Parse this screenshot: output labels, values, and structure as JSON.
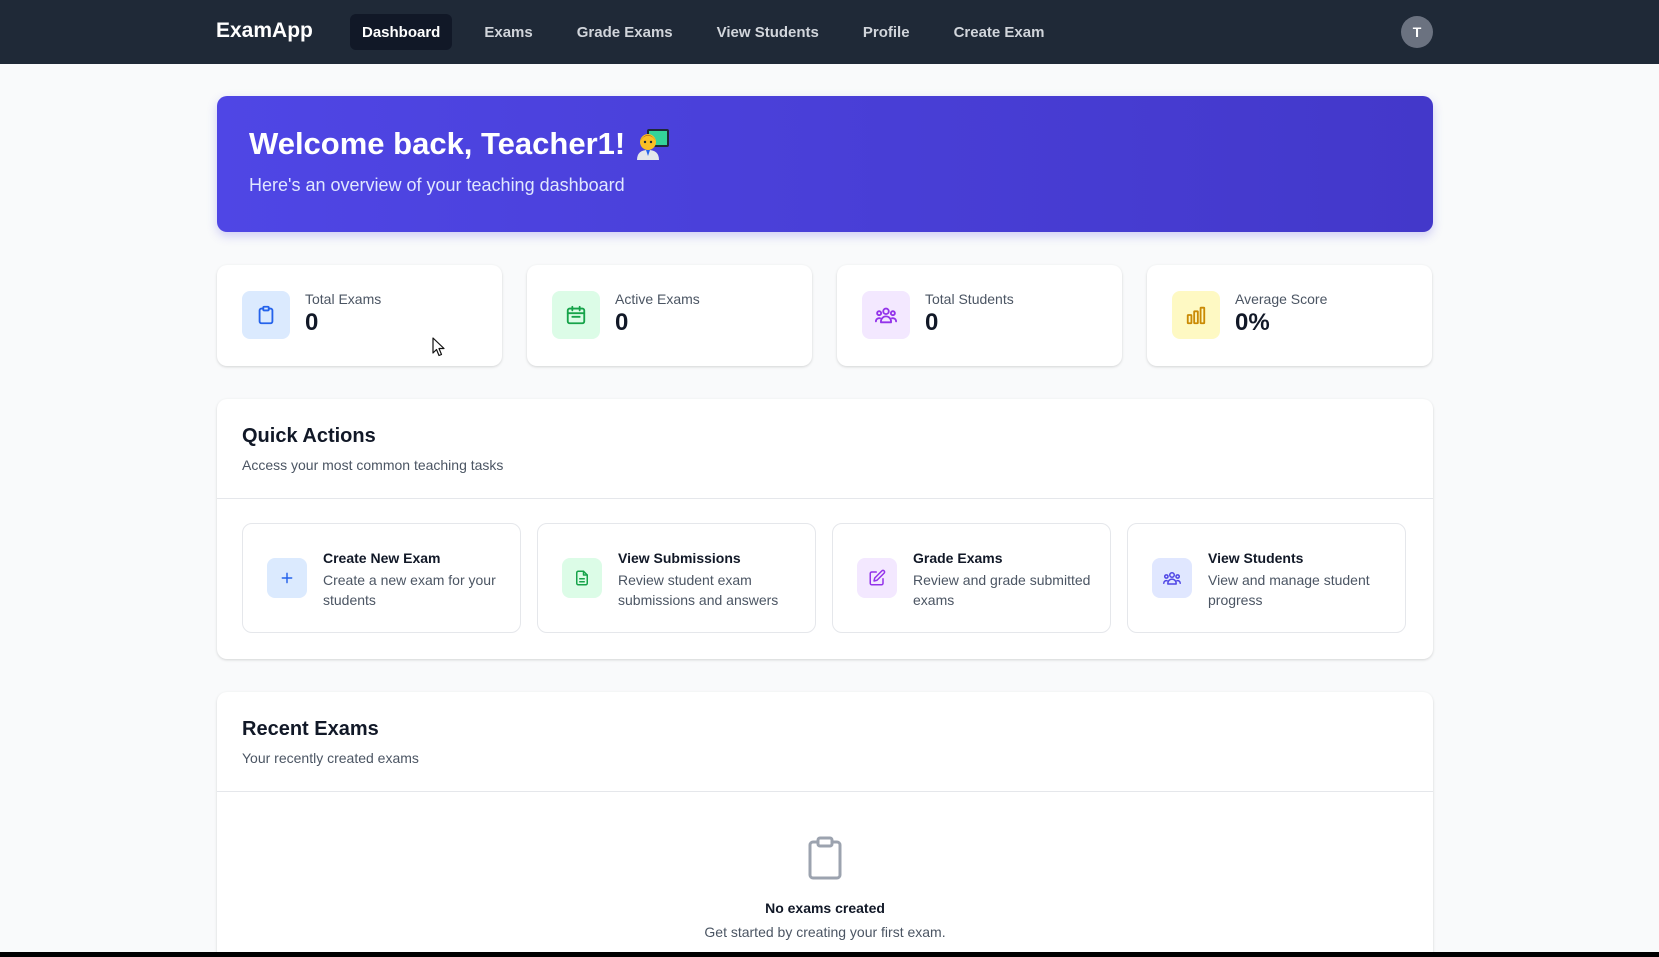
{
  "nav": {
    "brand": "ExamApp",
    "links": [
      {
        "label": "Dashboard",
        "active": true
      },
      {
        "label": "Exams"
      },
      {
        "label": "Grade Exams"
      },
      {
        "label": "View Students"
      },
      {
        "label": "Profile"
      },
      {
        "label": "Create Exam"
      }
    ],
    "avatar_initial": "T"
  },
  "hero": {
    "title": "Welcome back, Teacher1!",
    "emoji_icon": "teacher-icon",
    "subtitle": "Here's an overview of your teaching dashboard"
  },
  "stats": [
    {
      "label": "Total Exams",
      "value": "0",
      "icon": "clipboard-icon",
      "color": "#2563eb",
      "bg": "#dbeafe"
    },
    {
      "label": "Active Exams",
      "value": "0",
      "icon": "calendar-icon",
      "color": "#16a34a",
      "bg": "#dcfce7"
    },
    {
      "label": "Total Students",
      "value": "0",
      "icon": "users-icon",
      "color": "#9333ea",
      "bg": "#f3e8ff"
    },
    {
      "label": "Average Score",
      "value": "0%",
      "icon": "bar-chart-icon",
      "color": "#ca8a04",
      "bg": "#fef9c3"
    }
  ],
  "quick_actions": {
    "title": "Quick Actions",
    "subtitle": "Access your most common teaching tasks",
    "items": [
      {
        "title": "Create New Exam",
        "desc": "Create a new exam for your students",
        "icon": "plus-icon",
        "color": "#2563eb",
        "bg": "#dbeafe"
      },
      {
        "title": "View Submissions",
        "desc": "Review student exam submissions and answers",
        "icon": "document-icon",
        "color": "#16a34a",
        "bg": "#dcfce7"
      },
      {
        "title": "Grade Exams",
        "desc": "Review and grade submitted exams",
        "icon": "edit-icon",
        "color": "#9333ea",
        "bg": "#f3e8ff"
      },
      {
        "title": "View Students",
        "desc": "View and manage student progress",
        "icon": "users-icon",
        "color": "#4f46e5",
        "bg": "#e0e7ff"
      }
    ]
  },
  "recent_exams": {
    "title": "Recent Exams",
    "subtitle": "Your recently created exams",
    "empty_title": "No exams created",
    "empty_subtitle": "Get started by creating your first exam."
  }
}
